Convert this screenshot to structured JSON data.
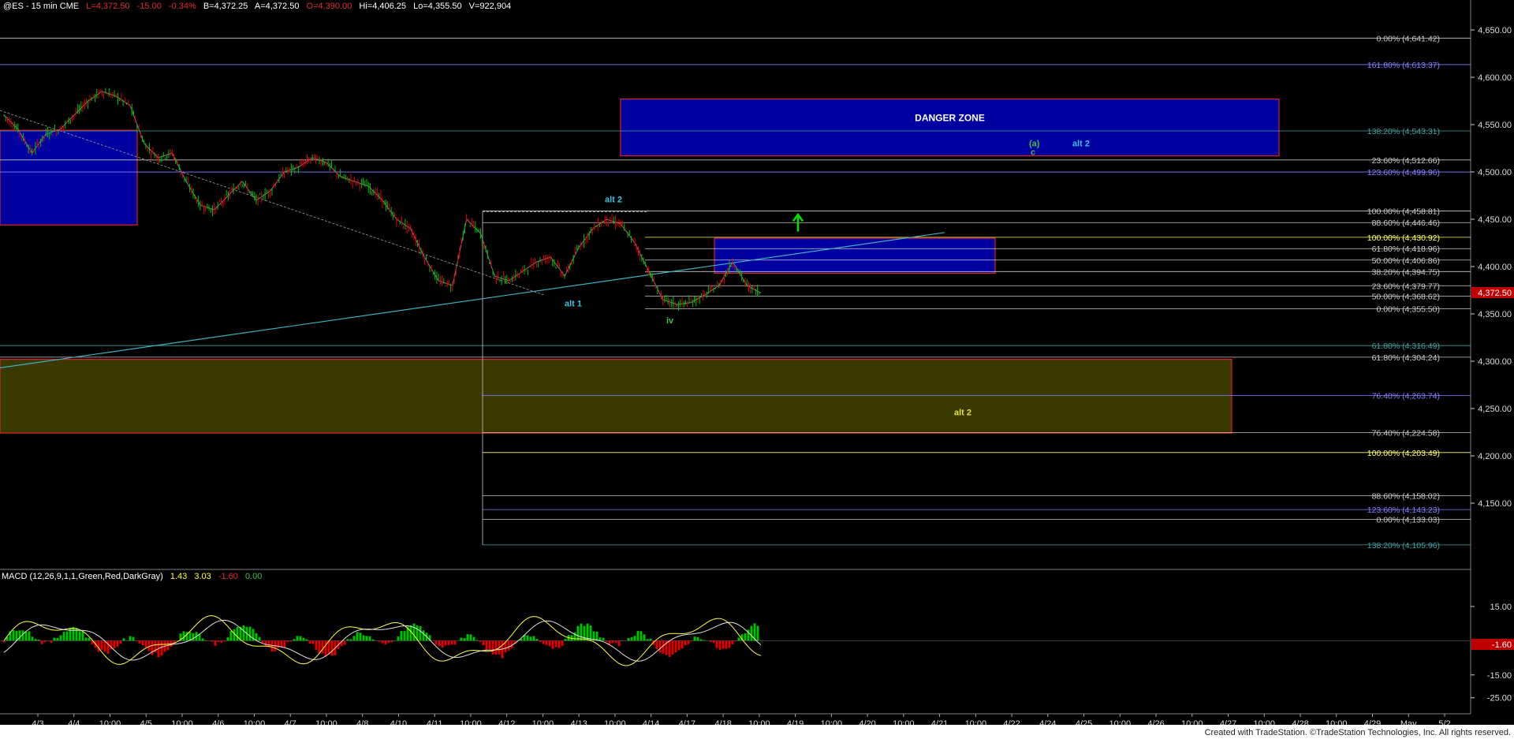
{
  "header": {
    "symbol": "@ES - 15 min  CME",
    "last": "L=4,372.50",
    "change": "-15.00",
    "pct": "-0.34%",
    "bid": "B=4,372.25",
    "ask": "A=4,372.50",
    "open": "O=4,390.00",
    "high": "Hi=4,406.25",
    "low": "Lo=4,355.50",
    "volume": "V=922,904"
  },
  "macd": {
    "label": "MACD (12,26,9,1,1,Green,Red,DarkGray)",
    "v1": "1.43",
    "v2": "3.03",
    "v3": "-1.60",
    "v4": "0.00"
  },
  "footer": "Created with TradeStation. ©TradeStation Technologies, Inc. All rights reserved.",
  "colors": {
    "bg": "#000000",
    "up": "#00c000",
    "down": "#e00000",
    "blue_zone": "#0000a0",
    "olive_zone": "#3a3a00",
    "trend": "#3fb0c0"
  },
  "chart_data": {
    "type": "candlestick",
    "ylim": [
      4080,
      4670
    ],
    "y_ticks": [
      "4,650.00",
      "4,600.00",
      "4,550.00",
      "4,500.00",
      "4,450.00",
      "4,400.00",
      "4,350.00",
      "4,300.00",
      "4,250.00",
      "4,200.00",
      "4,150.00"
    ],
    "y_tick_values": [
      4650,
      4600,
      4550,
      4500,
      4450,
      4400,
      4350,
      4300,
      4250,
      4200,
      4150
    ],
    "current_price_label": "4,372.50",
    "current_price": 4372.5,
    "x_labels": [
      "4/3",
      "4/4",
      "10:00",
      "4/5",
      "10:00",
      "4/6",
      "10:00",
      "4/7",
      "10:00",
      "4/8",
      "4/10",
      "4/11",
      "10:00",
      "4/12",
      "10:00",
      "4/13",
      "10:00",
      "4/14",
      "4/17",
      "4/18",
      "10:00",
      "4/19",
      "10:00",
      "4/20",
      "10:00",
      "4/21",
      "10:00",
      "4/22",
      "4/24",
      "4/25",
      "10:00",
      "4/26",
      "10:00",
      "4/27",
      "10:00",
      "4/28",
      "10:00",
      "4/29",
      "May",
      "5/2"
    ],
    "price_path": [
      [
        0,
        4560
      ],
      [
        2,
        4545
      ],
      [
        4,
        4520
      ],
      [
        6,
        4540
      ],
      [
        8,
        4545
      ],
      [
        10,
        4560
      ],
      [
        12,
        4575
      ],
      [
        14,
        4585
      ],
      [
        16,
        4580
      ],
      [
        18,
        4570
      ],
      [
        20,
        4530
      ],
      [
        22,
        4515
      ],
      [
        24,
        4520
      ],
      [
        26,
        4490
      ],
      [
        28,
        4465
      ],
      [
        30,
        4460
      ],
      [
        32,
        4475
      ],
      [
        34,
        4490
      ],
      [
        36,
        4470
      ],
      [
        38,
        4480
      ],
      [
        40,
        4500
      ],
      [
        42,
        4505
      ],
      [
        44,
        4515
      ],
      [
        46,
        4510
      ],
      [
        48,
        4495
      ],
      [
        50,
        4490
      ],
      [
        52,
        4485
      ],
      [
        54,
        4470
      ],
      [
        56,
        4450
      ],
      [
        58,
        4440
      ],
      [
        60,
        4410
      ],
      [
        62,
        4385
      ],
      [
        64,
        4380
      ],
      [
        66,
        4450
      ],
      [
        68,
        4435
      ],
      [
        70,
        4390
      ],
      [
        72,
        4385
      ],
      [
        74,
        4395
      ],
      [
        76,
        4405
      ],
      [
        78,
        4410
      ],
      [
        80,
        4390
      ],
      [
        82,
        4420
      ],
      [
        84,
        4440
      ],
      [
        86,
        4450
      ],
      [
        88,
        4445
      ],
      [
        90,
        4425
      ],
      [
        92,
        4395
      ],
      [
        94,
        4365
      ],
      [
        96,
        4360
      ],
      [
        98,
        4362
      ],
      [
        100,
        4370
      ],
      [
        102,
        4380
      ],
      [
        104,
        4405
      ],
      [
        106,
        4380
      ],
      [
        108,
        4372
      ]
    ],
    "price_path_x_units": "bar index (0-108 across 4/3 to 4/18)",
    "horizontal_levels": [
      {
        "label": "0.00% (4,641.42)",
        "value": 4641.42,
        "color": "#c8c8c8"
      },
      {
        "label": "161.80% (4,613.37)",
        "value": 4613.37,
        "color": "#8080ff"
      },
      {
        "label": "138.20% (4,543.31)",
        "value": 4543.31,
        "color": "#40a0a0"
      },
      {
        "label": "23.60% (4,512.66)",
        "value": 4512.66,
        "color": "#c8c8c8"
      },
      {
        "label": "123.60% (4,499.96)",
        "value": 4499.96,
        "color": "#8080ff"
      },
      {
        "label": "100.00% (4,458.81)",
        "value": 4458.81,
        "color": "#c8c8c8"
      },
      {
        "label": "88.60% (4,446.46)",
        "value": 4446.46,
        "color": "#c8c8c8"
      },
      {
        "label": "100.00% (4,430.92)",
        "value": 4430.92,
        "color": "#ffff60"
      },
      {
        "label": "61.80% (4,418.96)",
        "value": 4418.96,
        "color": "#c8c8c8"
      },
      {
        "label": "50.00% (4,406.86)",
        "value": 4406.86,
        "color": "#c8c8c8"
      },
      {
        "label": "38.20% (4,394.75)",
        "value": 4394.75,
        "color": "#c8c8c8"
      },
      {
        "label": "23.60% (4,379.77)",
        "value": 4379.77,
        "color": "#c8c8c8"
      },
      {
        "label": "50.00% (4,368.62)",
        "value": 4368.62,
        "color": "#c8c8c8"
      },
      {
        "label": "0.00% (4,355.50)",
        "value": 4355.5,
        "color": "#c8c8c8"
      },
      {
        "label": "61.80% (4,316.49)",
        "value": 4316.49,
        "color": "#40a0a0"
      },
      {
        "label": "61.80% (4,304.24)",
        "value": 4304.24,
        "color": "#c8c8c8"
      },
      {
        "label": "76.40% (4,263.74)",
        "value": 4263.74,
        "color": "#8080ff"
      },
      {
        "label": "76.40% (4,224.58)",
        "value": 4224.58,
        "color": "#c8c8c8"
      },
      {
        "label": "100.00% (4,203.49)",
        "value": 4203.49,
        "color": "#ffff60"
      },
      {
        "label": "88.60% (4,158.02)",
        "value": 4158.02,
        "color": "#c8c8c8"
      },
      {
        "label": "123.60% (4,143.23)",
        "value": 4143.23,
        "color": "#8080ff"
      },
      {
        "label": "0.00% (4,133.03)",
        "value": 4133.03,
        "color": "#c8c8c8"
      },
      {
        "label": "138.20% (4,105.96)",
        "value": 4105.96,
        "color": "#40a0a0"
      }
    ],
    "zones": [
      {
        "name": "danger",
        "label": "DANGER ZONE",
        "top": 4577,
        "bottom": 4517,
        "x_start": "4/14 (before)",
        "color": "#0000a0"
      },
      {
        "name": "left-blue",
        "top": 4544,
        "bottom": 4444,
        "color": "#0000a0"
      },
      {
        "name": "mid-blue",
        "top": 4430,
        "bottom": 4393,
        "color": "#0000a0"
      },
      {
        "name": "olive",
        "top": 4302,
        "bottom": 4224,
        "color": "#3a3a00"
      }
    ],
    "annotations": [
      {
        "text": "alt 2",
        "value": 4468,
        "color": "#40c0e0"
      },
      {
        "text": "alt 1",
        "value": 4358,
        "color": "#40c0e0"
      },
      {
        "text": "iv",
        "value": 4340,
        "color": "#40c040"
      },
      {
        "text": "(a)",
        "value": 4527,
        "color": "#40c040"
      },
      {
        "text": "c",
        "value": 4518,
        "color": "#40c040"
      },
      {
        "text": "alt 2",
        "value": 4527,
        "color": "#40c0e0"
      },
      {
        "text": "alt 2",
        "value": 4243,
        "color": "#e0e040"
      }
    ],
    "macd_ticks": [
      "15.00",
      "-15.00",
      "-25.00"
    ],
    "macd_tick_values": [
      15,
      -15,
      -25
    ],
    "macd_current_label": "-1.60"
  }
}
